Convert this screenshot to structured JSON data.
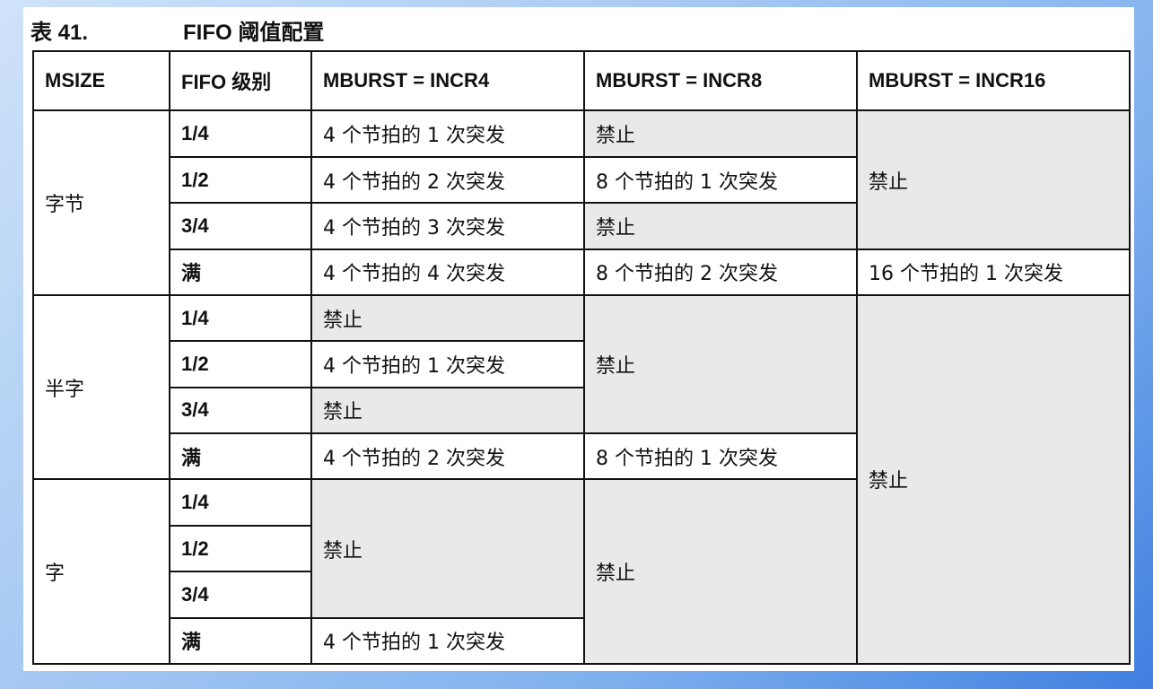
{
  "caption": {
    "number": "表 41.",
    "title": "FIFO 阈值配置"
  },
  "headers": {
    "msize": "MSIZE",
    "fifo_level": "FIFO 级别",
    "incr4": "MBURST = INCR4",
    "incr8": "MBURST = INCR8",
    "incr16": "MBURST = INCR16"
  },
  "msize": {
    "byte": "字节",
    "halfword": "半字",
    "word": "字"
  },
  "levels": {
    "q1": "1/4",
    "q2": "1/2",
    "q3": "3/4",
    "full": "满"
  },
  "cells": {
    "b_incr4_q1": "4 个节拍的 1 次突发",
    "b_incr4_q2": "4 个节拍的 2 次突发",
    "b_incr4_q3": "4 个节拍的 3 次突发",
    "b_incr4_full": "4 个节拍的 4 次突发",
    "b_incr8_q1": "禁止",
    "b_incr8_q2": "8 个节拍的 1 次突发",
    "b_incr8_q3": "禁止",
    "b_incr8_full": "8 个节拍的 2 次突发",
    "b_incr16_q123": "禁止",
    "b_incr16_full": "16 个节拍的 1 次突发",
    "h_incr4_q1": "禁止",
    "h_incr4_q2": "4 个节拍的 1 次突发",
    "h_incr4_q3": "禁止",
    "h_incr4_full": "4 个节拍的 2 次突发",
    "h_incr8_q123": "禁止",
    "h_incr8_full": "8 个节拍的 1 次突发",
    "hw_incr16": "禁止",
    "w_incr4_q123": "禁止",
    "w_incr4_full": "4 个节拍的 1 次突发",
    "w_incr8": "禁止"
  }
}
